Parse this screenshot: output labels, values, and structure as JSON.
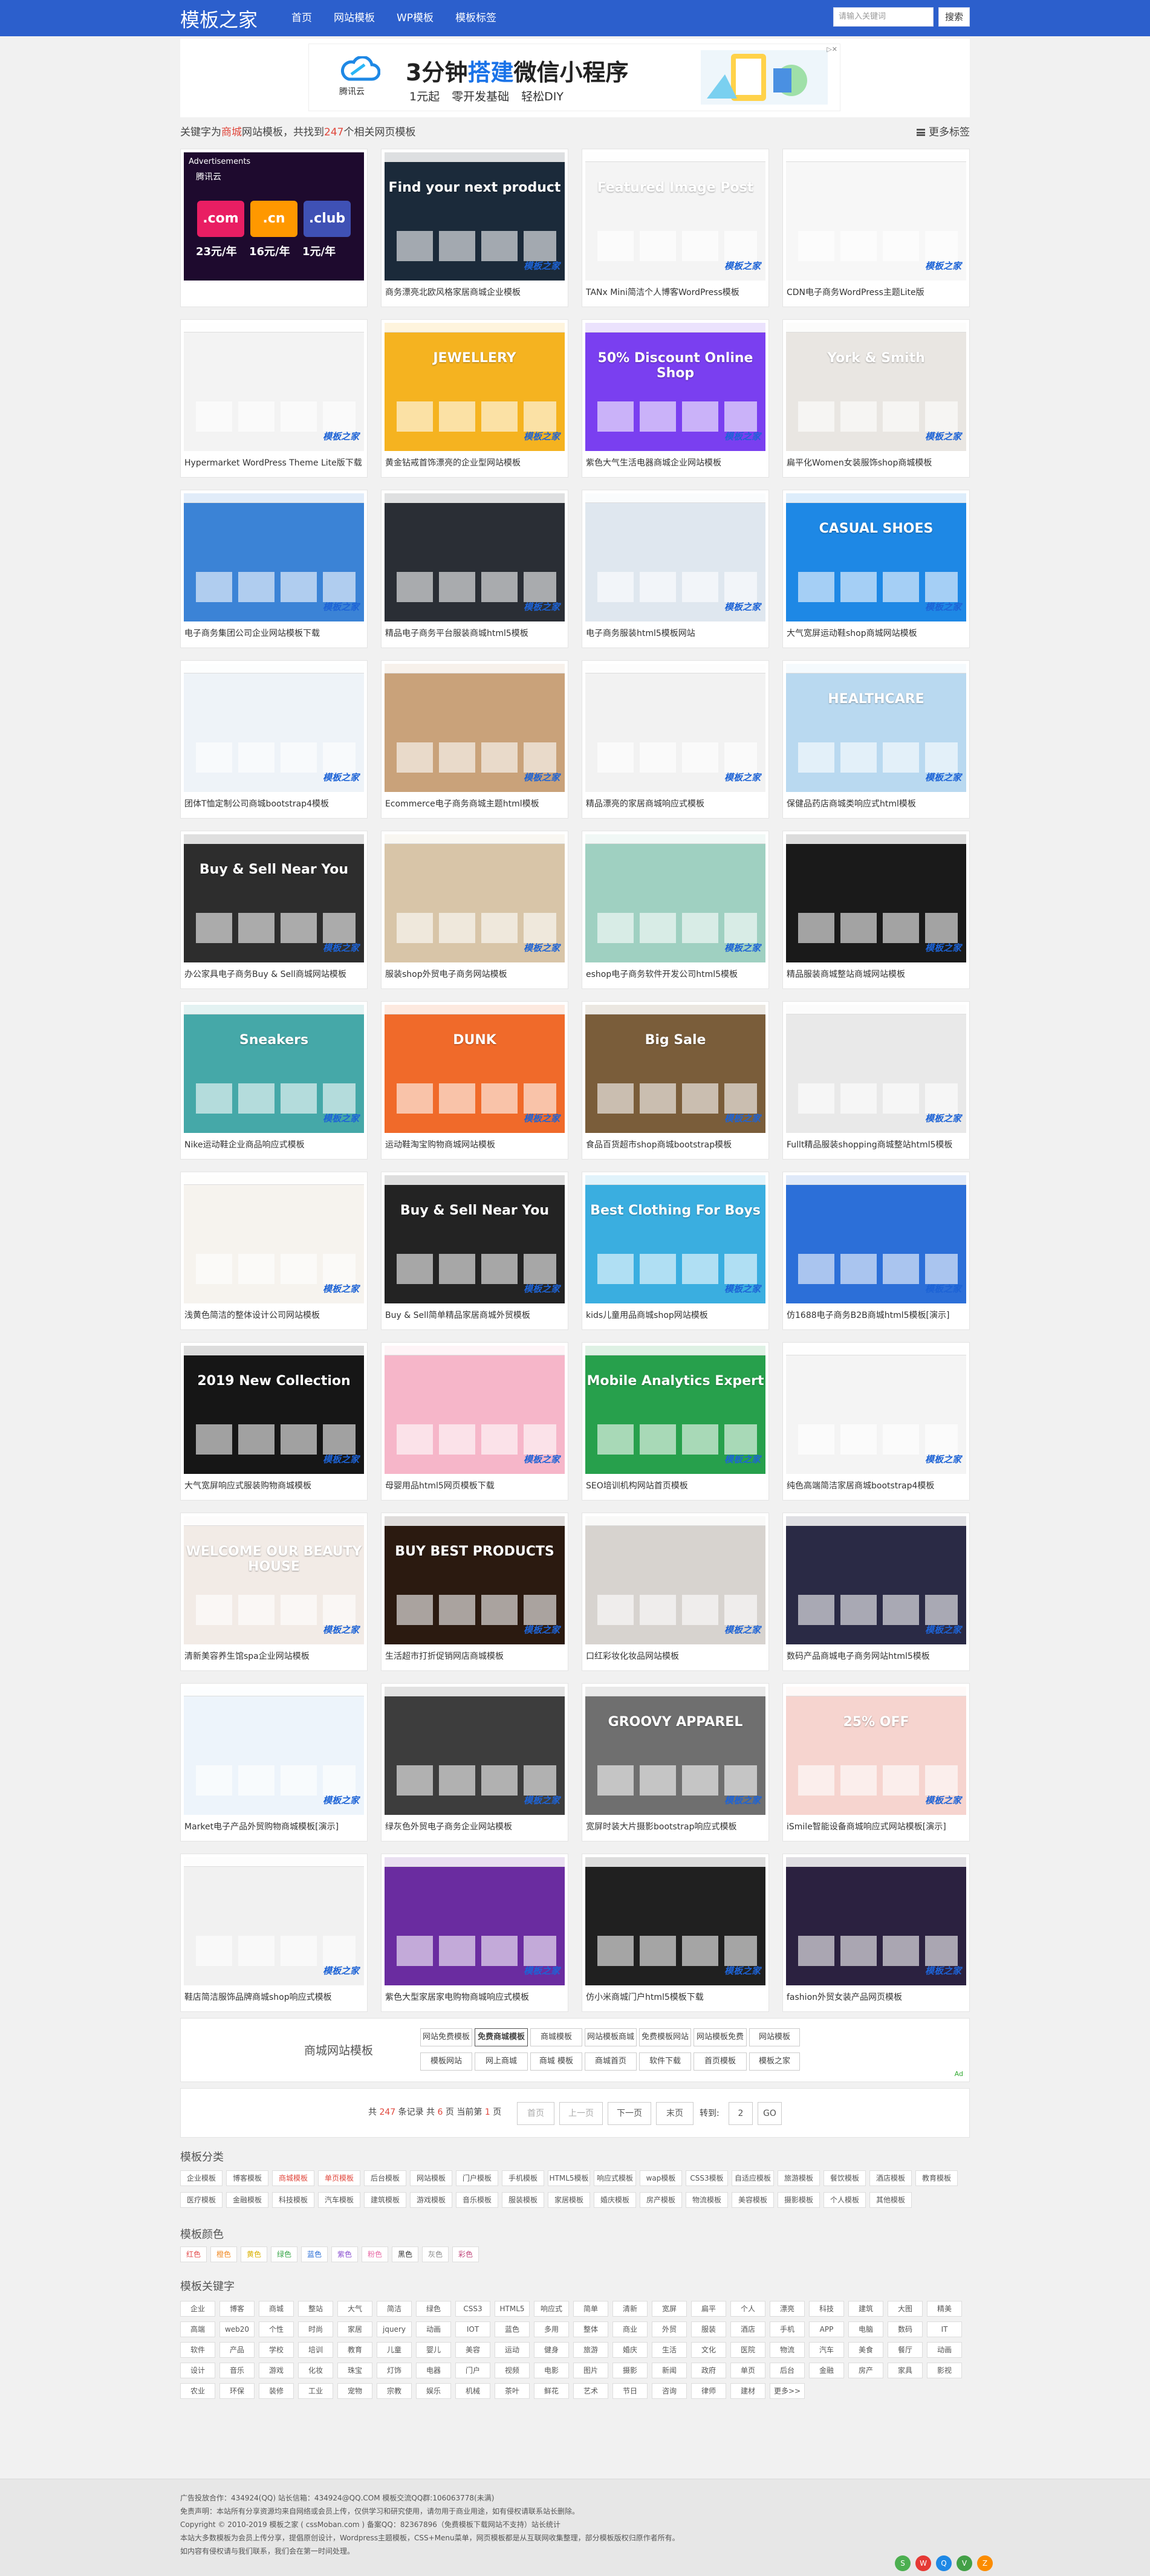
{
  "topbar": {
    "logo": "模板之家",
    "nav": [
      "首页",
      "网站模板",
      "WP模板",
      "模板标签"
    ],
    "search_placeholder": "请输入关键词",
    "search_button": "搜索"
  },
  "ad": {
    "brand": "腾讯云",
    "headline_pre": "3分钟",
    "headline_hl": "搭建",
    "headline_post": "微信小程序",
    "sub": "1元起 零开发基础 轻松DIY"
  },
  "result": {
    "pre": "关键字为",
    "keyword": "商城",
    "mid": "网站模板，共找到",
    "count": "247",
    "post": "个相关网页模板",
    "more_tags": "更多标签"
  },
  "adcard": {
    "label": "Advertisements",
    "brand": "腾讯云",
    "domains": [
      ".com",
      ".cn",
      ".club"
    ],
    "prices": [
      "23元/年",
      "16元/年",
      "1元/年"
    ]
  },
  "watermark": "模板之家",
  "cards": [
    {
      "caption": "",
      "color": "#1e0a2e",
      "title": ""
    },
    {
      "caption": "商务漂亮北欧风格家居商城企业模板",
      "color": "#1b2a3a",
      "title": "Find your next product"
    },
    {
      "caption": "TANx Mini简洁个人博客WordPress模板",
      "color": "#f4f4f4",
      "title": "Featured Image Post"
    },
    {
      "caption": "CDN电子商务WordPress主题Lite版",
      "color": "#f7f7f7",
      "title": ""
    },
    {
      "caption": "Hypermarket WordPress Theme Lite版下载",
      "color": "#f3f3f3",
      "title": ""
    },
    {
      "caption": "黄金钻戒首饰漂亮的企业型网站模板",
      "color": "#f5b320",
      "title": "JEWELLERY"
    },
    {
      "caption": "紫色大气生活电器商城企业网站模板",
      "color": "#7a3ff0",
      "title": "50% Discount Online Shop"
    },
    {
      "caption": "扁平化Women女装服饰shop商城模板",
      "color": "#e9e6e2",
      "title": "York & Smith"
    },
    {
      "caption": "电子商务集团公司企业网站模板下载",
      "color": "#3b83d6",
      "title": ""
    },
    {
      "caption": "精品电子商务平台服装商城html5模板",
      "color": "#2a2e35",
      "title": ""
    },
    {
      "caption": "电子商务服装html5模板网站",
      "color": "#dfe7ef",
      "title": ""
    },
    {
      "caption": "大气宽屏运动鞋shop商城网站模板",
      "color": "#1e88e5",
      "title": "CASUAL SHOES"
    },
    {
      "caption": "团体T恤定制公司商城bootstrap4模板",
      "color": "#eef3f8",
      "title": ""
    },
    {
      "caption": "Ecommerce电子商务商城主题html模板",
      "color": "#c9a27a",
      "title": ""
    },
    {
      "caption": "精品漂亮的家居商城响应式模板",
      "color": "#f2f2f2",
      "title": ""
    },
    {
      "caption": "保健品药店商城类响应式html模板",
      "color": "#b9d9f0",
      "title": "HEALTHCARE"
    },
    {
      "caption": "办公家具电子商务Buy & Sell商城网站模板",
      "color": "#2d2d2d",
      "title": "Buy & Sell Near You"
    },
    {
      "caption": "服装shop外贸电子商务网站模板",
      "color": "#d8c5a8",
      "title": ""
    },
    {
      "caption": "eshop电子商务软件开发公司html5模板",
      "color": "#9fd0c1",
      "title": ""
    },
    {
      "caption": "精品服装商城整站商城网站模板",
      "color": "#1a1a1a",
      "title": ""
    },
    {
      "caption": "Nike运动鞋企业商品响应式模板",
      "color": "#45a8a8",
      "title": "Sneakers"
    },
    {
      "caption": "运动鞋淘宝购物商城网站模板",
      "color": "#f06a2a",
      "title": "DUNK"
    },
    {
      "caption": "食品百货超市shop商城bootstrap模板",
      "color": "#7a5d3a",
      "title": "Big Sale"
    },
    {
      "caption": "Fullt精品服装shopping商城整站html5模板",
      "color": "#e9e9e9",
      "title": ""
    },
    {
      "caption": "浅黄色简洁的整体设计公司网站模板",
      "color": "#f6f3ee",
      "title": ""
    },
    {
      "caption": "Buy & Sell简单精品家居商城外贸模板",
      "color": "#232323",
      "title": "Buy & Sell Near You"
    },
    {
      "caption": "kids儿童用品商城shop网站模板",
      "color": "#3aaee0",
      "title": "Best Clothing For Boys"
    },
    {
      "caption": "仿1688电子商务B2B商城html5模板[演示]",
      "color": "#2c6fd8",
      "title": ""
    },
    {
      "caption": "大气宽屏响应式服装购物商城模板",
      "color": "#161616",
      "title": "2019 New Collection"
    },
    {
      "caption": "母婴用品html5网页模板下载",
      "color": "#f6b6c9",
      "title": ""
    },
    {
      "caption": "SEO培训机构网站首页模板",
      "color": "#27a04c",
      "title": "Mobile Analytics Expert"
    },
    {
      "caption": "纯色高端简洁家居商城bootstrap4模板",
      "color": "#f4f4f4",
      "title": ""
    },
    {
      "caption": "清新美容养生馆spa企业网站模板",
      "color": "#f2ebe6",
      "title": "WELCOME OUR BEAUTY HOUSE"
    },
    {
      "caption": "生活超市打折促销网店商城模板",
      "color": "#2b1a10",
      "title": "BUY BEST PRODUCTS"
    },
    {
      "caption": "口红彩妆化妆品网站模板",
      "color": "#d7d3cf",
      "title": ""
    },
    {
      "caption": "数码产品商城电子商务网站html5模板",
      "color": "#2a2a45",
      "title": ""
    },
    {
      "caption": "Market电子产品外贸购物商城模板[演示]",
      "color": "#edf4fb",
      "title": ""
    },
    {
      "caption": "绿灰色外贸电子商务企业网站模板",
      "color": "#3d3d3d",
      "title": ""
    },
    {
      "caption": "宽屏时装大片摄影bootstrap响应式模板",
      "color": "#6f6f6f",
      "title": "GROOVY APPAREL"
    },
    {
      "caption": "iSmile智能设备商城响应式网站模板[演示]",
      "color": "#f6d4cf",
      "title": "25% OFF"
    },
    {
      "caption": "鞋店简洁服饰品牌商城shop响应式模板",
      "color": "#f1f1f1",
      "title": ""
    },
    {
      "caption": "紫色大型家居家电购物商城响应式模板",
      "color": "#6a2ca0",
      "title": ""
    },
    {
      "caption": "仿小米商城门户html5模板下载",
      "color": "#202020",
      "title": ""
    },
    {
      "caption": "fashion外贸女装产品网页模板",
      "color": "#2b2140",
      "title": ""
    }
  ],
  "tag_row": {
    "label": "商城网站模板",
    "tags": [
      "网站免费模板",
      "免费商城模板",
      "商城模板",
      "网站模板商城",
      "免费模板网站",
      "网站模板免费",
      "网站模板",
      "模板网站",
      "网上商城",
      "商城 模板",
      "商城首页",
      "软件下载",
      "首页模板",
      "模板之家"
    ],
    "brand": "Ad"
  },
  "pagination": {
    "total_pre": "共",
    "total": "247",
    "total_mid": "条记录 共",
    "pages": "6",
    "pages_mid": "页 当前第",
    "current": "1",
    "pages_post": "页",
    "buttons": [
      "首页",
      "上一页",
      "下一页",
      "末页"
    ],
    "jump_label": "转到:",
    "jump_value": "2",
    "go": "GO"
  },
  "sections": {
    "category_title": "模板分类",
    "categories": [
      "企业模板",
      "博客模板",
      "商城模板",
      "单页模板",
      "后台模板",
      "网站模板",
      "门户模板",
      "手机模板",
      "HTML5模板",
      "响应式模板",
      "wap模板",
      "CSS3模板",
      "自适应模板",
      "旅游模板",
      "餐饮模板",
      "酒店模板",
      "教育模板",
      "医疗模板",
      "金融模板",
      "科技模板",
      "汽车模板",
      "建筑模板",
      "游戏模板",
      "音乐模板",
      "服装模板",
      "家居模板",
      "婚庆模板",
      "房产模板",
      "物流模板",
      "美容模板",
      "摄影模板",
      "个人模板",
      "其他模板"
    ],
    "color_title": "模板颜色",
    "colors": [
      {
        "name": "红色",
        "hex": "#e34b4b"
      },
      {
        "name": "橙色",
        "hex": "#f08a24"
      },
      {
        "name": "黄色",
        "hex": "#d9b000"
      },
      {
        "name": "绿色",
        "hex": "#3aa74a"
      },
      {
        "name": "蓝色",
        "hex": "#2a6ed6"
      },
      {
        "name": "紫色",
        "hex": "#8a4fd0"
      },
      {
        "name": "粉色",
        "hex": "#e86aa6"
      },
      {
        "name": "黑色",
        "hex": "#333333"
      },
      {
        "name": "灰色",
        "hex": "#888888"
      },
      {
        "name": "彩色",
        "hex": "#c0457a"
      }
    ],
    "keyword_title": "模板关键字",
    "keywords": [
      "企业",
      "博客",
      "商城",
      "整站",
      "大气",
      "简洁",
      "绿色",
      "CSS3",
      "HTML5",
      "响应式",
      "简单",
      "清新",
      "宽屏",
      "扁平",
      "个人",
      "漂亮",
      "科技",
      "建筑",
      "大图",
      "精美",
      "高端",
      "web20",
      "个性",
      "时尚",
      "家居",
      "jquery",
      "动画",
      "IOT",
      "蓝色",
      "多用",
      "整体",
      "商业",
      "外贸",
      "服装",
      "酒店",
      "手机",
      "APP",
      "电脑",
      "数码",
      "IT",
      "软件",
      "产品",
      "学校",
      "培训",
      "教育",
      "儿童",
      "婴儿",
      "美容",
      "运动",
      "健身",
      "旅游",
      "婚庆",
      "生活",
      "文化",
      "医院",
      "物流",
      "汽车",
      "美食",
      "餐厅",
      "动画",
      "设计",
      "音乐",
      "游戏",
      "化妆",
      "珠宝",
      "灯饰",
      "电器",
      "门户",
      "视频",
      "电影",
      "图片",
      "摄影",
      "新闻",
      "政府",
      "单页",
      "后台",
      "金融",
      "房产",
      "家具",
      "影视",
      "农业",
      "环保",
      "装修",
      "工业",
      "宠物",
      "宗教",
      "娱乐",
      "机械",
      "茶叶",
      "鲜花",
      "艺术",
      "节日",
      "咨询",
      "律师",
      "建材",
      "更多>>"
    ]
  },
  "footer": {
    "lines": [
      "广告投放合作：434924(QQ) 站长信箱：434924@QQ.COM 模板交流QQ群:106063778(未满)",
      "免责声明：本站所有分享资源均来自网络或会员上传，仅供学习和研究使用，请勿用于商业用途，如有侵权请联系站长删除。",
      "Copyright © 2010-2019 模板之家 ( cssMoban.com ) 备案QQ：82367896（免费模板下载网站不支持）站长统计",
      "本站大多数模板为会员上传分享，提倡原创设计，Wordpress主题模板，CSS+Menu菜单，网页模板都是从互联网收集整理，部分模板版权归原作者所有。",
      "如内容有侵权请与我们联系，我们会在第一时间处理。"
    ]
  }
}
